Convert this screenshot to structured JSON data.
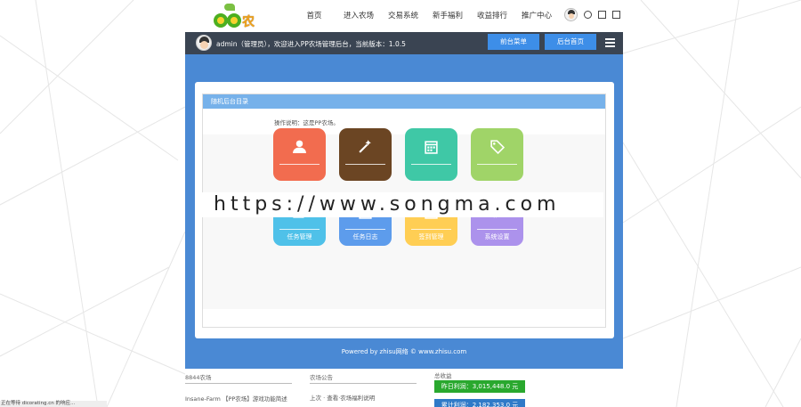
{
  "nav": {
    "logo_text": "农场",
    "links": [
      "首页",
      "进入农场",
      "交易系统",
      "新手福利",
      "收益排行",
      "推广中心"
    ]
  },
  "header": {
    "welcome": "admin（管理员），欢迎进入PP农场管理后台，当前版本：1.0.5",
    "btn_menu": "前台菜单",
    "btn_home": "后台首页"
  },
  "card": {
    "title": "随机后台目录",
    "note": "操作说明：这是PP农场。"
  },
  "tiles": [
    {
      "label": "",
      "color": "#f26c4f",
      "icon": "user-icon"
    },
    {
      "label": "",
      "color": "#6b4523",
      "icon": "magic-wand-icon"
    },
    {
      "label": "",
      "color": "#3fc8a6",
      "icon": "calendar-icon"
    },
    {
      "label": "",
      "color": "#a0d468",
      "icon": "tag-icon"
    },
    {
      "label": "任务管理",
      "color": "#4fc1e9",
      "icon": "edit-icon"
    },
    {
      "label": "任务日志",
      "color": "#5d9cec",
      "icon": "calendar-icon"
    },
    {
      "label": "签到管理",
      "color": "#ffce54",
      "icon": "checkbox-icon"
    },
    {
      "label": "系统设置",
      "color": "#ac92ec",
      "icon": "gears-icon"
    }
  ],
  "footer": "Powered by zhisu网络 © www.zhisu.com",
  "watermark": "https://www.songma.com",
  "bottom": {
    "col1_title": "8844农场",
    "col1_text": "Insane-Farm 【PP农场】游戏功能简述",
    "col2_title": "农场公告",
    "col2_text": "上次 · 查看·农场福利说明",
    "col3_title": "总收益",
    "stat1": "昨日利润：3,015,448.0 元",
    "stat2": "累计利润：2,182,353.0 元",
    "colors": {
      "stat1": "#29a82e",
      "stat2": "#2f7ac8"
    }
  },
  "statusbar": "正在等待 dicorating.cn 的响应..."
}
